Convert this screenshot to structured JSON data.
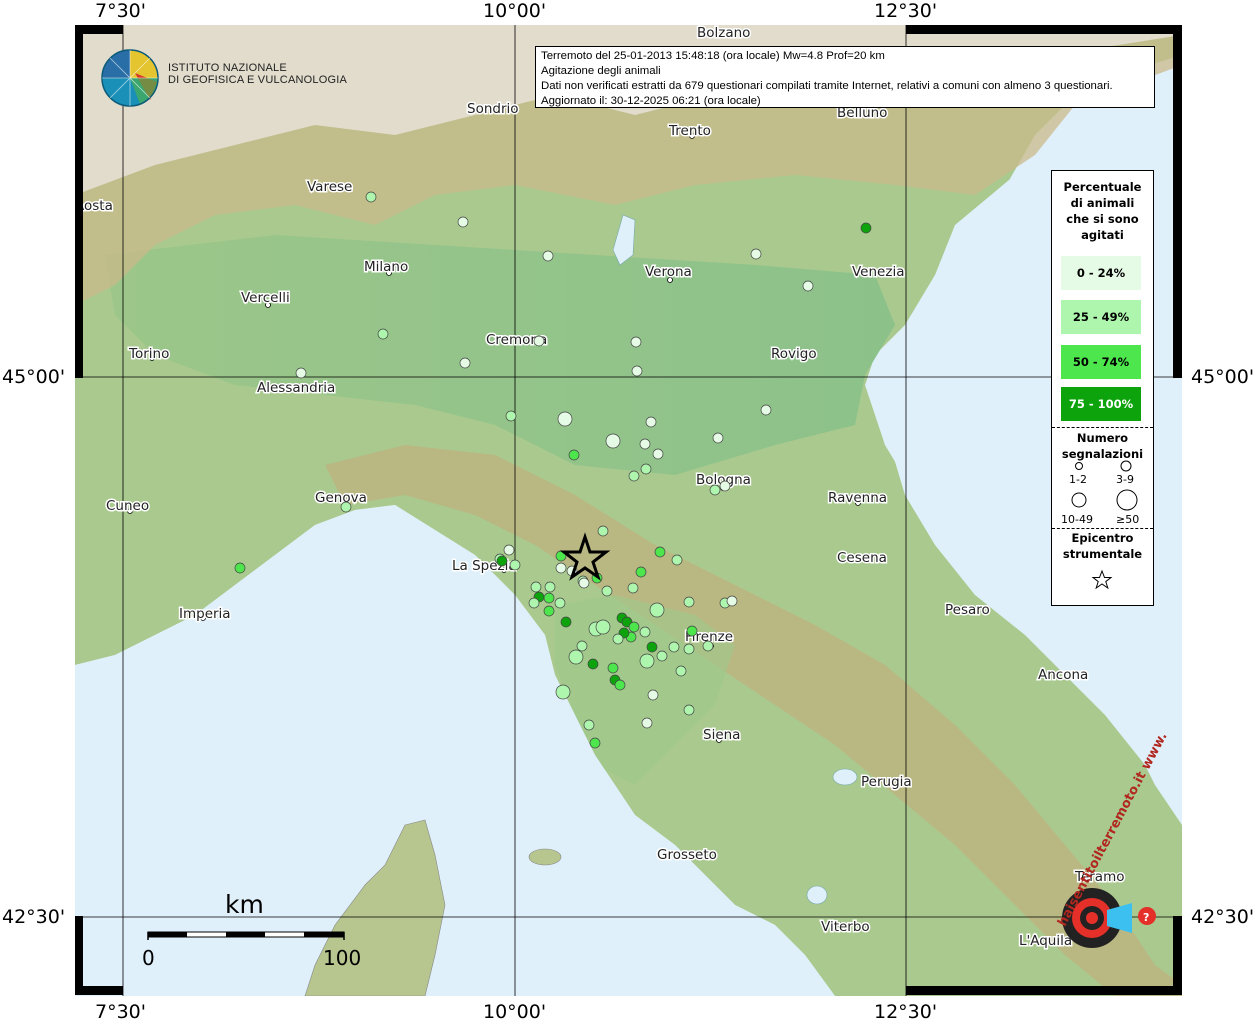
{
  "coords": {
    "top": [
      "7°30'",
      "10°00'",
      "12°30'"
    ],
    "bottom": [
      "7°30'",
      "10°00'",
      "12°30'"
    ],
    "left": [
      "45°00'",
      "42°30'"
    ],
    "right": [
      "45°00'",
      "42°30'"
    ]
  },
  "institute": {
    "line1": "ISTITUTO NAZIONALE",
    "line2": "DI GEOFISICA E VULCANOLOGIA"
  },
  "info": {
    "line1": "Terremoto del 25-01-2013 15:48:18 (ora locale) Mw=4.8 Prof=20 km",
    "line2": "Agitazione degli animali",
    "line3": "Dati non verificati estratti da 679 questionari compilati tramite Internet, relativi a comuni con almeno 3 questionari.",
    "line4": "Aggiornato il: 30-12-2025 06:21 (ora locale)"
  },
  "cities": {
    "bolzano": "Bolzano",
    "sondrio": "Sondrio",
    "trento": "Trento",
    "belluno": "Belluno",
    "aosta": "Aosta",
    "varese": "Varese",
    "milano": "Milano",
    "verona": "Verona",
    "venezia": "Venezia",
    "vercelli": "Vercelli",
    "cremona": "Cremona",
    "rovigo": "Rovigo",
    "torino": "Torino",
    "alessandria": "Alessandria",
    "bologna": "Bologna",
    "ravenna": "Ravenna",
    "cuneo": "Cuneo",
    "genova": "Genova",
    "laspezia": "La Spezia",
    "cesena": "Cesena",
    "pesaro": "Pesaro",
    "imperia": "Imperia",
    "firenze": "Firenze",
    "ancona": "Ancona",
    "siena": "Siena",
    "perugia": "Perugia",
    "grosseto": "Grosseto",
    "teramo": "Teramo",
    "viterbo": "Viterbo",
    "laquila": "L'Aquila"
  },
  "legend": {
    "title": [
      "Percentuale",
      "di animali",
      "che si sono",
      "agitati"
    ],
    "classes": [
      {
        "label": "0 - 24%",
        "color": "#e6fbe6"
      },
      {
        "label": "25 - 49%",
        "color": "#aef5ae"
      },
      {
        "label": "50 - 74%",
        "color": "#4de64d"
      },
      {
        "label": "75 - 100%",
        "color": "#0ca30c"
      }
    ],
    "count_title": [
      "Numero",
      "segnalazioni"
    ],
    "sizes": [
      "1-2",
      "3-9",
      "10-49",
      "≥50"
    ],
    "epicenter_title": [
      "Epicentro",
      "strumentale"
    ]
  },
  "scale": {
    "unit": "km",
    "start": "0",
    "end": "100"
  },
  "watermark": "haisentitoilterremoto.it  www."
}
